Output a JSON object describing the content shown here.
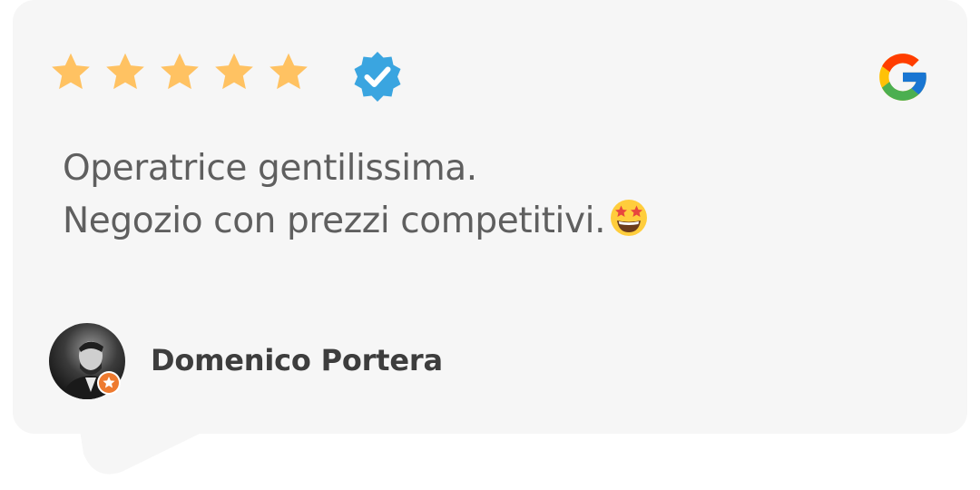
{
  "review": {
    "rating": 5,
    "max_rating": 5,
    "verified": true,
    "source_icon": "google-g-logo",
    "text_lines": [
      "Operatrice gentilissima.",
      "Negozio con prezzi competitivi."
    ],
    "emoji": "star-struck-emoji",
    "author_name": "Domenico Portera",
    "author_badge": "star-badge-icon"
  },
  "colors": {
    "card_background": "#f6f6f6",
    "star": "#ffc262",
    "verified_badge": "#3aa5e0",
    "text": "#5f5f5f",
    "author": "#3d3d3d",
    "badge": "#ee7a2f"
  }
}
